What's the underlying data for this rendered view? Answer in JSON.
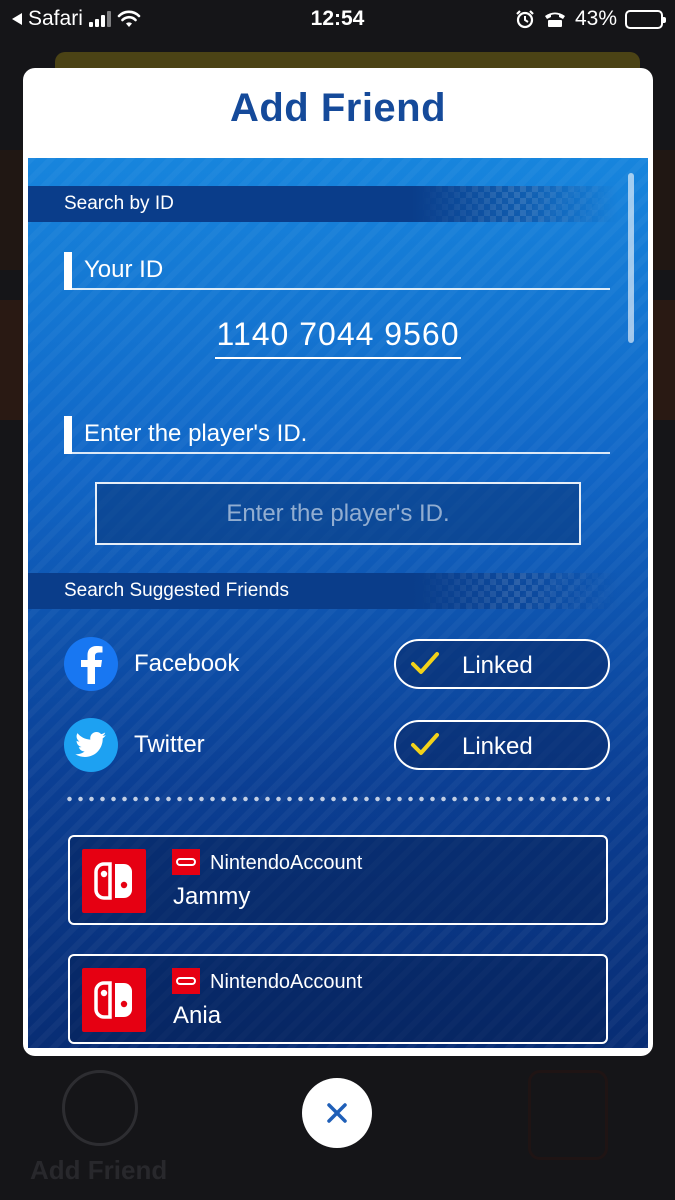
{
  "status_bar": {
    "back_app": "Safari",
    "time": "12:54",
    "battery": "43%",
    "battery_level": 0.43
  },
  "background": {
    "bottom_label": "Add Friend"
  },
  "modal": {
    "title": "Add Friend",
    "search_by_id": {
      "section_label": "Search by ID",
      "your_id_label": "Your ID",
      "your_id_value": "1140  7044  9560",
      "enter_label": "Enter the player's ID.",
      "input_placeholder": "Enter the player's ID.",
      "input_value": ""
    },
    "suggested": {
      "section_label": "Search Suggested Friends",
      "socials": [
        {
          "name": "Facebook",
          "icon": "facebook-icon",
          "status": "Linked",
          "color": "#1877f2"
        },
        {
          "name": "Twitter",
          "icon": "twitter-icon",
          "status": "Linked",
          "color": "#1da1f2"
        }
      ],
      "accounts": [
        {
          "type": "NintendoAccount",
          "name": "Jammy",
          "icon": "nintendo-switch-icon"
        },
        {
          "type": "NintendoAccount",
          "name": "Ania",
          "icon": "nintendo-switch-icon"
        }
      ]
    }
  },
  "colors": {
    "title": "#154a9a",
    "panel_top": "#1785dd",
    "panel_bottom": "#082d74",
    "check": "#f2d21a",
    "nintendo_red": "#e60012"
  },
  "close_button": {
    "icon": "close-icon"
  }
}
